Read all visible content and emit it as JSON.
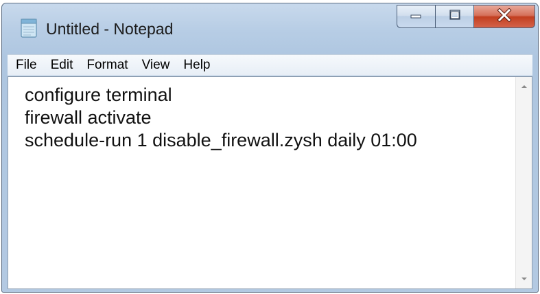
{
  "window": {
    "title": "Untitled - Notepad",
    "icon": "notepad-icon"
  },
  "caption_buttons": {
    "minimize_icon": "minimize-icon",
    "maximize_icon": "maximize-icon",
    "close_icon": "close-icon",
    "close_color": "#c9442a"
  },
  "menu": {
    "items": [
      {
        "label": "File"
      },
      {
        "label": "Edit"
      },
      {
        "label": "Format"
      },
      {
        "label": "View"
      },
      {
        "label": "Help"
      }
    ]
  },
  "editor": {
    "lines": [
      "configure terminal",
      "firewall activate",
      "schedule-run 1 disable_firewall.zysh daily 01:00"
    ]
  },
  "scrollbar": {
    "up_icon": "scroll-up-arrow-icon",
    "down_icon": "scroll-down-arrow-icon"
  }
}
